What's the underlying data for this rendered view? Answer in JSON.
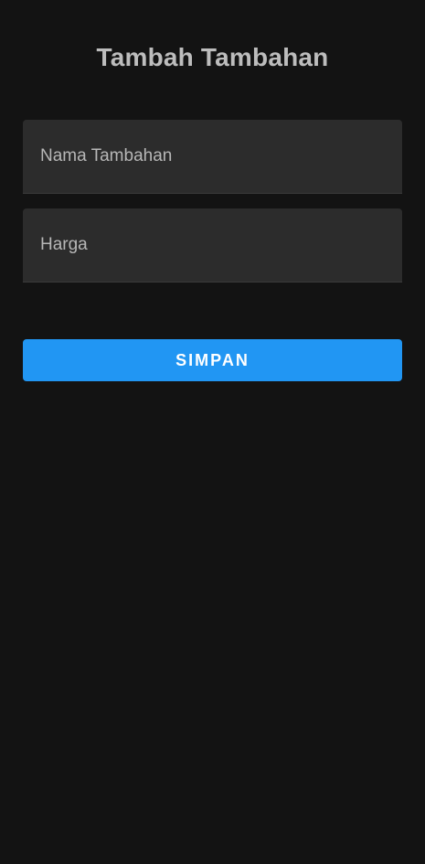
{
  "header": {
    "title": "Tambah Tambahan"
  },
  "form": {
    "name_field": {
      "placeholder": "Nama Tambahan",
      "value": ""
    },
    "price_field": {
      "placeholder": "Harga",
      "value": ""
    },
    "save_label": "SIMPAN"
  },
  "colors": {
    "background": "#131313",
    "field_background": "#2c2c2c",
    "accent": "#2196f3",
    "title_text": "#bdbdbd"
  }
}
